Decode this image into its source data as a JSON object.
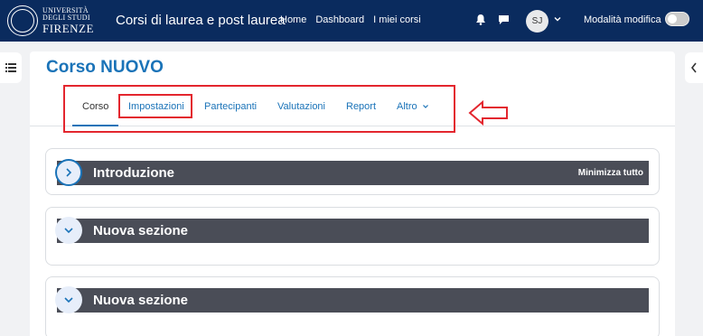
{
  "header": {
    "logo": {
      "line1": "UNIVERSITÀ",
      "line2": "DEGLI STUDI",
      "line3": "FIRENZE"
    },
    "site_title": "Corsi di laurea e post laurea",
    "nav": [
      "Home",
      "Dashboard",
      "I miei corsi"
    ],
    "avatar_initials": "SJ",
    "edit_mode_label": "Modalità modifica",
    "edit_mode_on": false
  },
  "course": {
    "title": "Corso NUOVO",
    "tabs": [
      {
        "label": "Corso",
        "active": true
      },
      {
        "label": "Impostazioni",
        "active": false
      },
      {
        "label": "Partecipanti",
        "active": false
      },
      {
        "label": "Valutazioni",
        "active": false
      },
      {
        "label": "Report",
        "active": false
      },
      {
        "label": "Altro",
        "active": false
      }
    ]
  },
  "sections": [
    {
      "title": "Introduzione",
      "expanded": false
    },
    {
      "title": "Nuova sezione",
      "expanded": true
    },
    {
      "title": "Nuova sezione",
      "expanded": true
    }
  ],
  "collapse_all_label": "Minimizza tutto",
  "colors": {
    "navbar": "#0a2b5e",
    "accent": "#1a73b8",
    "annotation": "#e3262e",
    "section_bar": "#4a4d57"
  },
  "icons": [
    "bell-icon",
    "chat-icon",
    "chevron-down-icon",
    "list-icon",
    "chevron-left-icon",
    "chevron-right-icon",
    "arrow-left-icon"
  ]
}
